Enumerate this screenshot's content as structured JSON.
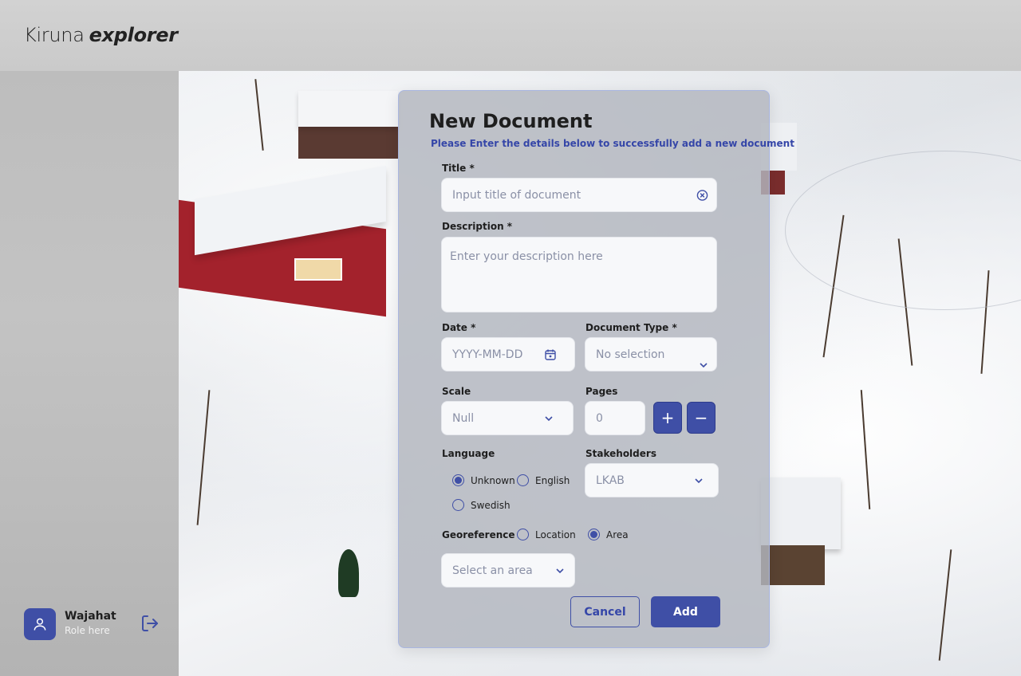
{
  "brand": {
    "part1": "Kiruna",
    "part2": "explorer"
  },
  "user": {
    "name": "Wajahat",
    "role": "Role here"
  },
  "modal": {
    "title": "New Document",
    "subtitle": "Please Enter the details below to successfully add a new document",
    "title_field": {
      "label": "Title *",
      "placeholder": "Input title of document"
    },
    "description_field": {
      "label": "Description *",
      "placeholder": "Enter your description here"
    },
    "date_field": {
      "label": "Date *",
      "placeholder": "YYYY-MM-DD"
    },
    "doc_type_field": {
      "label": "Document Type *",
      "value": "No selection"
    },
    "scale_field": {
      "label": "Scale",
      "value": "Null"
    },
    "pages_field": {
      "label": "Pages",
      "value": "0",
      "plus": "+",
      "minus": "−"
    },
    "language": {
      "label": "Language",
      "options": [
        {
          "label": "Unknown",
          "selected": true
        },
        {
          "label": "English",
          "selected": false
        },
        {
          "label": "Swedish",
          "selected": false
        }
      ]
    },
    "stakeholders_field": {
      "label": "Stakeholders",
      "value": "LKAB"
    },
    "georeference": {
      "label": "Georeference",
      "options": [
        {
          "label": "Location",
          "selected": false
        },
        {
          "label": "Area",
          "selected": true
        }
      ]
    },
    "area_select": {
      "placeholder": "Select an area"
    },
    "cancel_label": "Cancel",
    "add_label": "Add"
  },
  "colors": {
    "accent": "#3f4fa6",
    "subtitle": "#3546a8"
  }
}
